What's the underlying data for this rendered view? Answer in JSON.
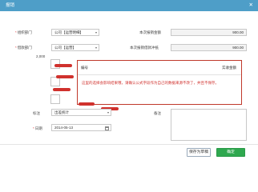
{
  "window": {
    "title": "报销",
    "close_symbol": "✕"
  },
  "form": {
    "org_dept": {
      "label": "组织部门",
      "value": "公司【运营明细】"
    },
    "current_amount": {
      "label": "本次报销金额",
      "value": "900.00"
    },
    "payee_dept": {
      "label": "借款部门",
      "value": "公司【运营】"
    },
    "repay_amount": {
      "label": "本次报销借款冲抵",
      "value": "900.00"
    },
    "small_number": "2,000",
    "category": {
      "label": "标注",
      "value": "出差统计"
    },
    "remark": {
      "label": "备注"
    },
    "date": {
      "label": "日期",
      "value": "2014-05-13"
    }
  },
  "popup": {
    "col1": "编号",
    "col2": "实收金额",
    "message": "这里的选择会影响结果哦，请确认公式字段作为自己的数据来源不改了，并且不保存。"
  },
  "buttons": {
    "save_draft": "保存为草稿",
    "submit": "确定"
  },
  "colors": {
    "title_bar": "#4e9ec8",
    "submit": "#2fa84f",
    "alert_border": "#c0392b",
    "alert_text": "#d0312d",
    "required": "#e03c3c"
  }
}
